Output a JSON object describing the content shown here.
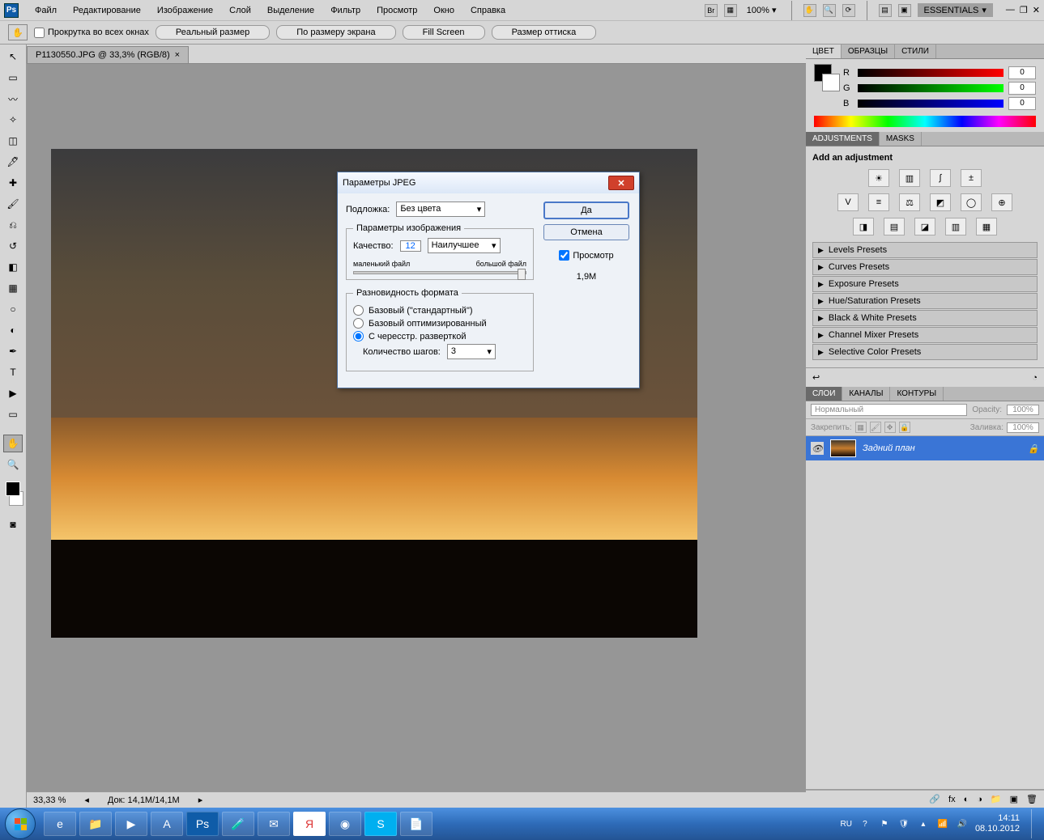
{
  "menu": {
    "items": [
      "Файл",
      "Редактирование",
      "Изображение",
      "Слой",
      "Выделение",
      "Фильтр",
      "Просмотр",
      "Окно",
      "Справка"
    ],
    "zoom": "100%",
    "workspace": "ESSENTIALS"
  },
  "options": {
    "tool_icon": "✋",
    "checkbox": "Прокрутка во всех окнах",
    "buttons": [
      "Реальный размер",
      "По размеру экрана",
      "Fill Screen",
      "Размер оттиска"
    ]
  },
  "doc": {
    "tab": "P1130550.JPG @ 33,3% (RGB/8)",
    "status_zoom": "33,33 %",
    "status_doc": "Док: 14,1M/14,1M"
  },
  "color": {
    "tabs": [
      "ЦВЕТ",
      "ОБРАЗЦЫ",
      "СТИЛИ"
    ],
    "r": "0",
    "g": "0",
    "b": "0"
  },
  "adjust": {
    "tabs": [
      "ADJUSTMENTS",
      "MASKS"
    ],
    "heading": "Add an adjustment",
    "presets": [
      "Levels Presets",
      "Curves Presets",
      "Exposure Presets",
      "Hue/Saturation Presets",
      "Black & White Presets",
      "Channel Mixer Presets",
      "Selective Color Presets"
    ]
  },
  "layers": {
    "tabs": [
      "СЛОИ",
      "КАНАЛЫ",
      "КОНТУРЫ"
    ],
    "blend": "Нормальный",
    "opacity_lbl": "Opacity:",
    "opacity": "100%",
    "lock_lbl": "Закрепить:",
    "fill_lbl": "Заливка:",
    "fill": "100%",
    "row": "Задний план"
  },
  "dialog": {
    "title": "Параметры JPEG",
    "matte_lbl": "Подложка:",
    "matte_val": "Без цвета",
    "image_legend": "Параметры изображения",
    "quality_lbl": "Качество:",
    "quality_val": "12",
    "quality_preset": "Наилучшее",
    "small": "маленький файл",
    "large": "большой файл",
    "format_legend": "Разновидность формата",
    "fmt1": "Базовый (\"стандартный\")",
    "fmt2": "Базовый оптимизированный",
    "fmt3": "С чересстр. разверткой",
    "scans_lbl": "Количество шагов:",
    "scans_val": "3",
    "ok": "Да",
    "cancel": "Отмена",
    "preview": "Просмотр",
    "size": "1,9M"
  },
  "taskbar": {
    "lang": "RU",
    "time": "14:11",
    "date": "08.10.2012"
  }
}
